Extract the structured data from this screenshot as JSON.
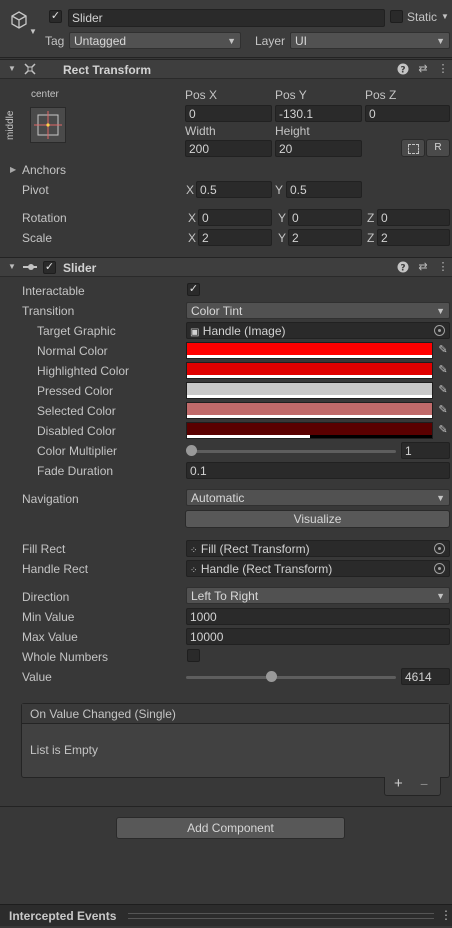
{
  "object": {
    "name": "Slider",
    "static_label": "Static",
    "tag_label": "Tag",
    "tag_value": "Untagged",
    "layer_label": "Layer",
    "layer_value": "UI"
  },
  "rect_transform": {
    "title": "Rect Transform",
    "anchor_h": "center",
    "anchor_v": "middle",
    "pos_x_label": "Pos X",
    "pos_y_label": "Pos Y",
    "pos_z_label": "Pos Z",
    "pos_x": "0",
    "pos_y": "-130.1",
    "pos_z": "0",
    "width_label": "Width",
    "height_label": "Height",
    "width": "200",
    "height": "20",
    "blueprint_btn": "R",
    "anchors_label": "Anchors",
    "pivot_label": "Pivot",
    "pivot_x": "0.5",
    "pivot_y": "0.5",
    "rotation_label": "Rotation",
    "rot_x": "0",
    "rot_y": "0",
    "rot_z": "0",
    "scale_label": "Scale",
    "scale_x": "2",
    "scale_y": "2",
    "scale_z": "2",
    "x": "X",
    "y": "Y",
    "z": "Z"
  },
  "slider": {
    "title": "Slider",
    "interactable_label": "Interactable",
    "transition_label": "Transition",
    "transition_value": "Color Tint",
    "target_graphic_label": "Target Graphic",
    "target_graphic_value": "Handle (Image)",
    "normal_color_label": "Normal Color",
    "highlighted_color_label": "Highlighted Color",
    "pressed_color_label": "Pressed Color",
    "selected_color_label": "Selected Color",
    "disabled_color_label": "Disabled Color",
    "color_multiplier_label": "Color Multiplier",
    "color_multiplier_value": "1",
    "fade_duration_label": "Fade Duration",
    "fade_duration_value": "0.1",
    "navigation_label": "Navigation",
    "navigation_value": "Automatic",
    "visualize_label": "Visualize",
    "fill_rect_label": "Fill Rect",
    "fill_rect_value": "Fill (Rect Transform)",
    "handle_rect_label": "Handle Rect",
    "handle_rect_value": "Handle (Rect Transform)",
    "direction_label": "Direction",
    "direction_value": "Left To Right",
    "min_value_label": "Min Value",
    "min_value": "1000",
    "max_value_label": "Max Value",
    "max_value": "10000",
    "whole_numbers_label": "Whole Numbers",
    "value_label": "Value",
    "value": "4614",
    "event_title": "On Value Changed (Single)",
    "event_empty": "List is Empty",
    "plus": "+",
    "minus": "−"
  },
  "colors": {
    "normal": "#ff0000",
    "highlighted": "#e00000",
    "pressed": "#c8c8c8",
    "selected": "#c06a6a",
    "disabled": "#5a0000"
  },
  "add_component_label": "Add Component",
  "intercepted_events_label": "Intercepted Events"
}
